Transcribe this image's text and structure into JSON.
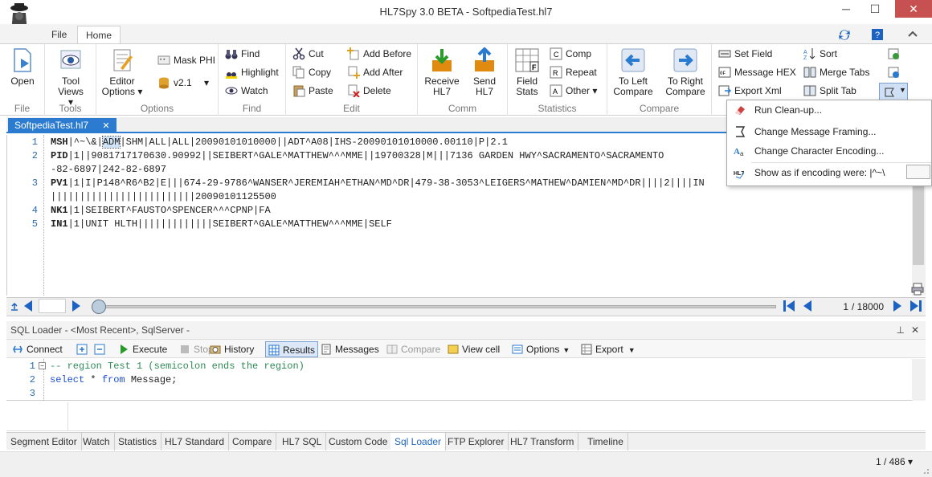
{
  "window": {
    "title": "HL7Spy 3.0 BETA - SoftpediaTest.hl7",
    "minimize": "─",
    "maximize": "☐",
    "close": "✕"
  },
  "ribbon_tabs": {
    "file": "File",
    "home": "Home"
  },
  "ribbon": {
    "file_group": {
      "label": "File",
      "open": "Open"
    },
    "tools_group": {
      "label": "Tools",
      "tool_views": "Tool Views ▾"
    },
    "options_group": {
      "label": "Options",
      "editor_options": "Editor Options ▾",
      "mask_phi": "Mask PHI",
      "version": "v2.1",
      "version_arrow": "▾"
    },
    "find_group": {
      "label": "Find",
      "find": "Find",
      "highlight": "Highlight",
      "watch": "Watch"
    },
    "edit_group": {
      "label": "Edit",
      "cut": "Cut",
      "copy": "Copy",
      "paste": "Paste",
      "add_before": "Add Before",
      "add_after": "Add After",
      "delete": "Delete"
    },
    "comm_group": {
      "label": "Comm",
      "receive": "Receive HL7",
      "send": "Send HL7"
    },
    "stats_group": {
      "label": "Statistics",
      "field_stats": "Field Stats",
      "comp": "Comp",
      "repeat": "Repeat",
      "other": "Other ▾"
    },
    "compare_group": {
      "label": "Compare",
      "to_left": "To Left Compare",
      "to_right": "To Right Compare"
    },
    "misc_group": {
      "set_field": "Set Field",
      "message_hex": "Message HEX",
      "export_xml": "Export Xml",
      "sort": "Sort",
      "merge_tabs": "Merge Tabs",
      "split_tab": "Split Tab"
    }
  },
  "document_tab": {
    "name": "SoftpediaTest.hl7",
    "close": "✕"
  },
  "editor": {
    "lines": [
      {
        "num": "1",
        "seg": "MSH",
        "pre": "|^~\\&|",
        "sel": "ADM",
        "rest": "|SHM|ALL|ALL|20090101010000||ADT^A08|IHS-20090101010000.00110|P|2.1"
      },
      {
        "num": "2",
        "seg": "PID",
        "pre": "",
        "sel": "",
        "rest": "|1||9081717170630.90992||SEIBERT^GALE^MATTHEW^^^MME||19700328|M|||7136 GARDEN HWY^SACRAMENTO^SACRAMENTO"
      },
      {
        "num": "",
        "seg": "",
        "pre": "",
        "sel": "",
        "rest": "-82-6897|242-82-6897"
      },
      {
        "num": "3",
        "seg": "PV1",
        "pre": "",
        "sel": "",
        "rest": "|1|I|P148^R6^B2|E|||674-29-9786^WANSER^JEREMIAH^ETHAN^MD^DR|479-38-3053^LEIGERS^MATHEW^DAMIEN^MD^DR||||2||||IN"
      },
      {
        "num": "",
        "seg": "",
        "pre": "",
        "sel": "",
        "rest": "|||||||||||||||||||||||||20090101125500"
      },
      {
        "num": "4",
        "seg": "NK1",
        "pre": "",
        "sel": "",
        "rest": "|1|SEIBERT^FAUSTO^SPENCER^^^CPNP|FA"
      },
      {
        "num": "5",
        "seg": "IN1",
        "pre": "",
        "sel": "",
        "rest": "|1|UNIT HLTH|||||||||||||SEIBERT^GALE^MATTHEW^^^MME|SELF"
      }
    ]
  },
  "navigator": {
    "current": "1",
    "total": "/ 18000"
  },
  "sql_loader": {
    "header": "SQL Loader - <Most Recent>, SqlServer -",
    "pin": "⊥",
    "close": "✕",
    "toolbar": {
      "connect": "Connect",
      "execute": "Execute",
      "stop": "Stop",
      "history": "History",
      "results": "Results",
      "messages": "Messages",
      "compare": "Compare",
      "view_cell": "View cell",
      "options": "Options",
      "export": "Export"
    },
    "lines": [
      {
        "num": "1",
        "text": "-- region Test 1 (semicolon ends the region)"
      },
      {
        "num": "2",
        "kw1": "select",
        "mid": " * ",
        "kw2": "from",
        "end": " Message;"
      },
      {
        "num": "3",
        "text": ""
      }
    ]
  },
  "bottom_tabs": [
    "Segment Editor",
    "Watch",
    "Statistics",
    "HL7 Standard",
    "Compare",
    "HL7 SQL",
    "Custom Code",
    "Sql Loader",
    "FTP Explorer",
    "HL7 Transform",
    "Timeline"
  ],
  "active_bottom_tab": "Sql Loader",
  "status": {
    "page": "1 / 486 ▾"
  },
  "popup_menu": {
    "items": [
      "Run Clean-up...",
      "Change Message Framing...",
      "Change Character Encoding...",
      "Show as if encoding were: |^~\\"
    ]
  },
  "colors": {
    "accent": "#2b7bd0",
    "segment_num": "#2b6cb0",
    "sql_comment": "#2e8b57",
    "sql_keyword": "#1f4fd1"
  }
}
